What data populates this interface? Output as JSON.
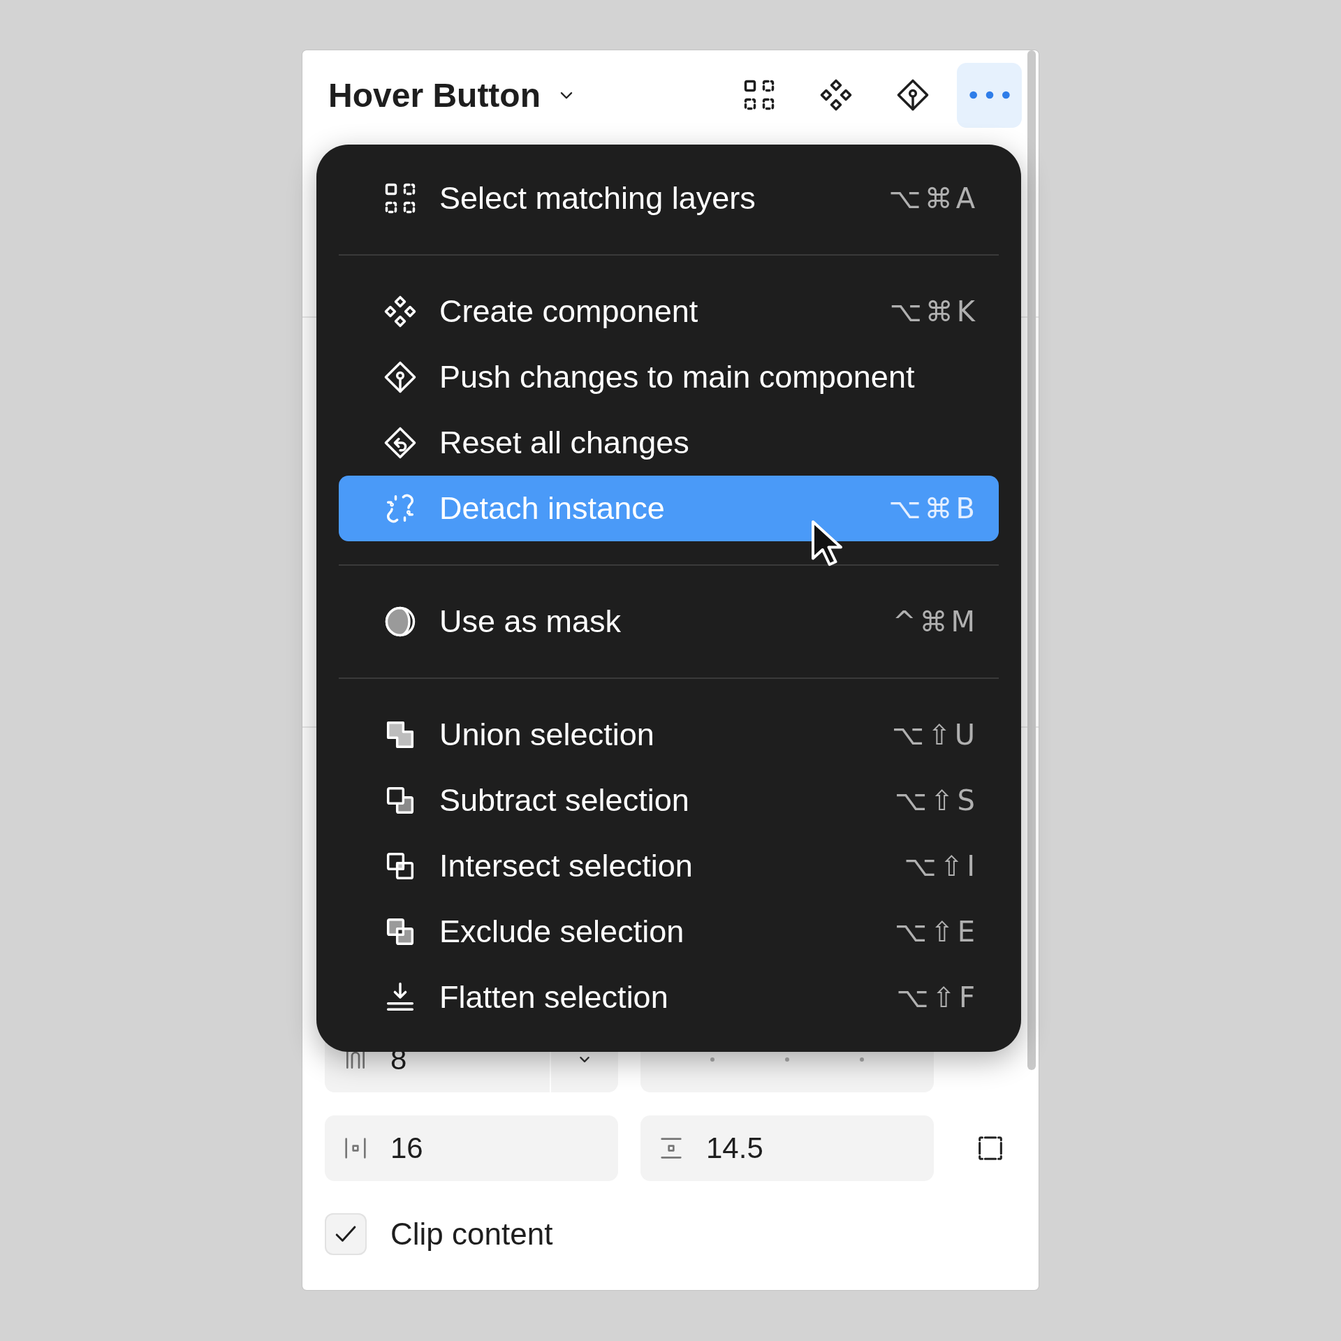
{
  "header": {
    "title": "Hover Button",
    "toolbar": [
      {
        "selected": false
      },
      {
        "selected": false
      },
      {
        "selected": false
      },
      {
        "selected": true
      }
    ]
  },
  "menu": {
    "groups": [
      [
        {
          "label": "Select matching layers",
          "shortcut": "⌥⌘A",
          "selected": false
        }
      ],
      [
        {
          "label": "Create component",
          "shortcut": "⌥⌘K",
          "selected": false
        },
        {
          "label": "Push changes to main component",
          "selected": false
        },
        {
          "label": "Reset all changes",
          "selected": false
        },
        {
          "label": "Detach instance",
          "shortcut": "⌥⌘B",
          "selected": true
        }
      ],
      [
        {
          "label": "Use as mask",
          "shortcut": "^⌘M",
          "selected": false
        }
      ],
      [
        {
          "label": "Union selection",
          "shortcut": "⌥⇧U",
          "selected": false
        },
        {
          "label": "Subtract selection",
          "shortcut": "⌥⇧S",
          "selected": false
        },
        {
          "label": "Intersect selection",
          "shortcut": "⌥⇧I",
          "selected": false
        },
        {
          "label": "Exclude selection",
          "shortcut": "⌥⇧E",
          "selected": false
        },
        {
          "label": "Flatten selection",
          "shortcut": "⌥⇧F",
          "selected": false
        }
      ]
    ]
  },
  "layout": {
    "gap": {
      "value": "8"
    },
    "padding_horizontal": {
      "value": "16"
    },
    "padding_vertical": {
      "value": "14.5"
    }
  },
  "clip_content": {
    "label": "Clip content",
    "checked": true
  }
}
